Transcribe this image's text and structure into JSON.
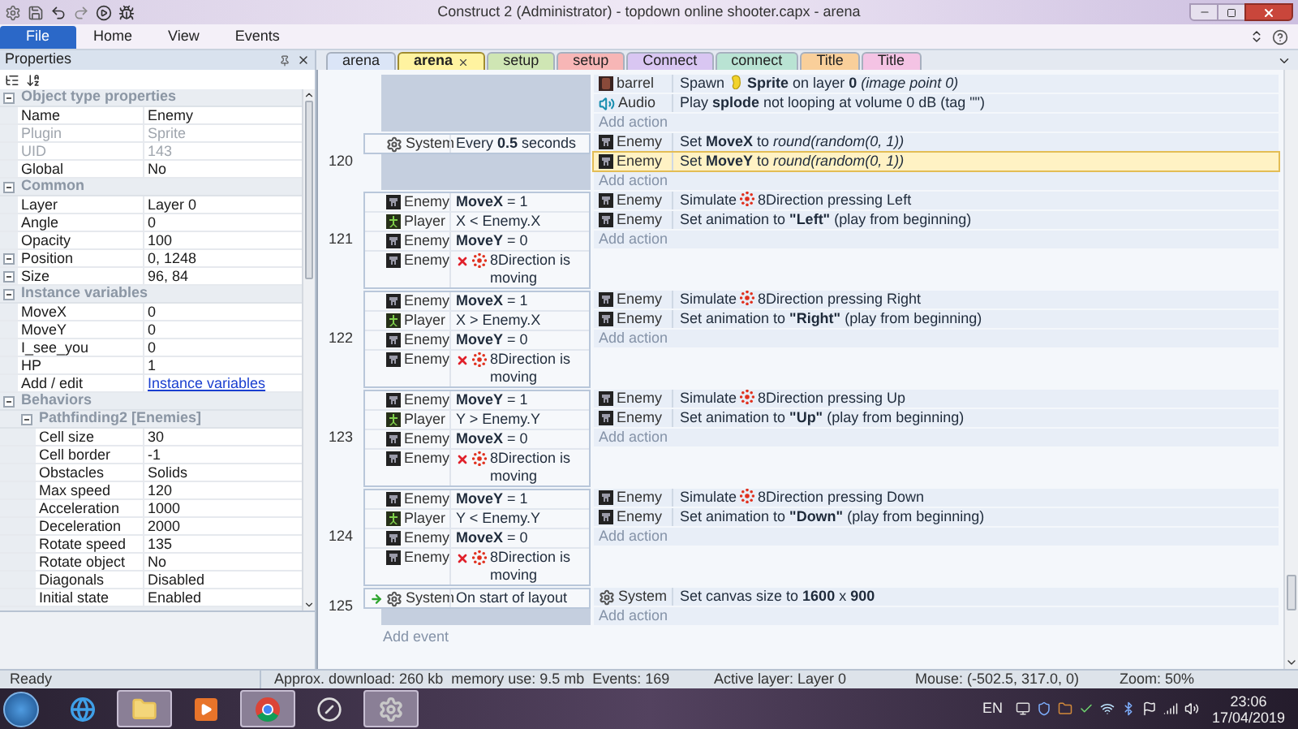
{
  "window": {
    "title": "Construct 2 (Administrator) - topdown online shooter.capx - arena"
  },
  "ribbon": [
    {
      "label": "File",
      "kind": "appmenu"
    },
    {
      "label": "Home",
      "kind": "tab"
    },
    {
      "label": "View",
      "kind": "tab"
    },
    {
      "label": "Events",
      "kind": "tab"
    }
  ],
  "properties": {
    "title": "Properties",
    "sections": [
      {
        "label": "Object type properties",
        "expanded": true,
        "rows": [
          {
            "name": "Name",
            "value": "Enemy",
            "disabled": false,
            "expandable": false,
            "link": false
          },
          {
            "name": "Plugin",
            "value": "Sprite",
            "disabled": true,
            "expandable": false,
            "link": false
          },
          {
            "name": "UID",
            "value": "143",
            "disabled": true,
            "expandable": false,
            "link": false
          },
          {
            "name": "Global",
            "value": "No",
            "disabled": false,
            "expandable": false,
            "link": false
          }
        ]
      },
      {
        "label": "Common",
        "expanded": true,
        "rows": [
          {
            "name": "Layer",
            "value": "Layer 0",
            "disabled": false,
            "expandable": false,
            "link": false
          },
          {
            "name": "Angle",
            "value": "0",
            "disabled": false,
            "expandable": false,
            "link": false
          },
          {
            "name": "Opacity",
            "value": "100",
            "disabled": false,
            "expandable": false,
            "link": false
          },
          {
            "name": "Position",
            "value": "0, 1248",
            "disabled": false,
            "expandable": true,
            "link": false
          },
          {
            "name": "Size",
            "value": "96, 84",
            "disabled": false,
            "expandable": true,
            "link": false
          }
        ]
      },
      {
        "label": "Instance variables",
        "expanded": true,
        "rows": [
          {
            "name": "MoveX",
            "value": "0",
            "disabled": false,
            "expandable": false,
            "link": false
          },
          {
            "name": "MoveY",
            "value": "0",
            "disabled": false,
            "expandable": false,
            "link": false
          },
          {
            "name": "I_see_you",
            "value": "0",
            "disabled": false,
            "expandable": false,
            "link": false
          },
          {
            "name": "HP",
            "value": "1",
            "disabled": false,
            "expandable": false,
            "link": false
          },
          {
            "name": "Add / edit",
            "value": "Instance variables",
            "disabled": false,
            "expandable": false,
            "link": true
          }
        ]
      },
      {
        "label": "Behaviors",
        "expanded": true,
        "subsections": [
          {
            "label": "Pathfinding2 [Enemies]",
            "expanded": true,
            "rows": [
              {
                "name": "Cell size",
                "value": "30",
                "disabled": false,
                "expandable": false,
                "link": false
              },
              {
                "name": "Cell border",
                "value": "-1",
                "disabled": false,
                "expandable": false,
                "link": false
              },
              {
                "name": "Obstacles",
                "value": "Solids",
                "disabled": false,
                "expandable": false,
                "link": false
              },
              {
                "name": "Max speed",
                "value": "120",
                "disabled": false,
                "expandable": false,
                "link": false
              },
              {
                "name": "Acceleration",
                "value": "1000",
                "disabled": false,
                "expandable": false,
                "link": false
              },
              {
                "name": "Deceleration",
                "value": "2000",
                "disabled": false,
                "expandable": false,
                "link": false
              },
              {
                "name": "Rotate speed",
                "value": "135",
                "disabled": false,
                "expandable": false,
                "link": false
              },
              {
                "name": "Rotate object",
                "value": "No",
                "disabled": false,
                "expandable": false,
                "link": false
              },
              {
                "name": "Diagonals",
                "value": "Disabled",
                "disabled": false,
                "expandable": false,
                "link": false
              },
              {
                "name": "Initial state",
                "value": "Enabled",
                "disabled": false,
                "expandable": false,
                "link": false
              }
            ]
          }
        ]
      }
    ]
  },
  "tabs": [
    {
      "label": "arena",
      "color": "#dbe5f7",
      "selected": false
    },
    {
      "label": "arena",
      "color": "#fff3a0",
      "selected": true
    },
    {
      "label": "setup",
      "color": "#cfe6b4",
      "selected": false
    },
    {
      "label": "setup",
      "color": "#f7b6b6",
      "selected": false
    },
    {
      "label": "Connect",
      "color": "#d9c6f2",
      "selected": false
    },
    {
      "label": "connect",
      "color": "#b9e3d3",
      "selected": false
    },
    {
      "label": "Title",
      "color": "#f9cf9a",
      "selected": false
    },
    {
      "label": "Title",
      "color": "#f4c3e4",
      "selected": false
    }
  ],
  "events": [
    {
      "actions": [
        {
          "object": "barrel",
          "kind": "barrel",
          "lead": "Spawn",
          "inline_icon": true,
          "text": "**Sprite** on layer **0** *(image point 0)*",
          "selected": false
        },
        {
          "object": "Audio",
          "kind": "audio",
          "inline_icon": false,
          "text": "Play **splode** not looping at volume 0 dB (tag \"\")",
          "selected": false
        }
      ],
      "add_action": "Add action"
    },
    {
      "number": "120",
      "trigger": false,
      "conditions": [
        {
          "object": "System",
          "kind": "system",
          "inline_icon": false,
          "text": "Every **0.5** seconds",
          "inverted": false
        }
      ],
      "actions": [
        {
          "object": "Enemy",
          "kind": "enemy",
          "inline_icon": false,
          "text": "Set **MoveX** to *round(random(0, 1))*",
          "selected": false
        },
        {
          "object": "Enemy",
          "kind": "enemy",
          "inline_icon": false,
          "text": "Set **MoveY** to *round(random(0, 1))*",
          "selected": true
        }
      ],
      "add_action": "Add action"
    },
    {
      "number": "121",
      "trigger": false,
      "conditions": [
        {
          "object": "Enemy",
          "kind": "enemy",
          "inline_icon": false,
          "text": "**MoveX** = 1",
          "inverted": false
        },
        {
          "object": "Player",
          "kind": "player",
          "inline_icon": false,
          "text": "X < Enemy.X",
          "inverted": false
        },
        {
          "object": "Enemy",
          "kind": "enemy",
          "inline_icon": false,
          "text": "**MoveY** = 0",
          "inverted": false
        },
        {
          "object": "Enemy",
          "kind": "enemy",
          "inline_icon": true,
          "text": "8Direction is moving",
          "inverted": true
        }
      ],
      "actions": [
        {
          "object": "Enemy",
          "kind": "enemy",
          "lead": "Simulate",
          "inline_icon": true,
          "text": "8Direction pressing Left",
          "selected": false
        },
        {
          "object": "Enemy",
          "kind": "enemy",
          "inline_icon": false,
          "text": "Set animation to **\"Left\"** (play from beginning)",
          "selected": false
        }
      ],
      "add_action": "Add action"
    },
    {
      "number": "122",
      "trigger": false,
      "conditions": [
        {
          "object": "Enemy",
          "kind": "enemy",
          "inline_icon": false,
          "text": "**MoveX** = 1",
          "inverted": false
        },
        {
          "object": "Player",
          "kind": "player",
          "inline_icon": false,
          "text": "X > Enemy.X",
          "inverted": false
        },
        {
          "object": "Enemy",
          "kind": "enemy",
          "inline_icon": false,
          "text": "**MoveY** = 0",
          "inverted": false
        },
        {
          "object": "Enemy",
          "kind": "enemy",
          "inline_icon": true,
          "text": "8Direction is moving",
          "inverted": true
        }
      ],
      "actions": [
        {
          "object": "Enemy",
          "kind": "enemy",
          "lead": "Simulate",
          "inline_icon": true,
          "text": "8Direction pressing Right",
          "selected": false
        },
        {
          "object": "Enemy",
          "kind": "enemy",
          "inline_icon": false,
          "text": "Set animation to **\"Right\"** (play from beginning)",
          "selected": false
        }
      ],
      "add_action": "Add action"
    },
    {
      "number": "123",
      "trigger": false,
      "conditions": [
        {
          "object": "Enemy",
          "kind": "enemy",
          "inline_icon": false,
          "text": "**MoveY** = 1",
          "inverted": false
        },
        {
          "object": "Player",
          "kind": "player",
          "inline_icon": false,
          "text": "Y > Enemy.Y",
          "inverted": false
        },
        {
          "object": "Enemy",
          "kind": "enemy",
          "inline_icon": false,
          "text": "**MoveX** = 0",
          "inverted": false
        },
        {
          "object": "Enemy",
          "kind": "enemy",
          "inline_icon": true,
          "text": "8Direction is moving",
          "inverted": true
        }
      ],
      "actions": [
        {
          "object": "Enemy",
          "kind": "enemy",
          "lead": "Simulate",
          "inline_icon": true,
          "text": "8Direction pressing Up",
          "selected": false
        },
        {
          "object": "Enemy",
          "kind": "enemy",
          "inline_icon": false,
          "text": "Set animation to **\"Up\"** (play from beginning)",
          "selected": false
        }
      ],
      "add_action": "Add action"
    },
    {
      "number": "124",
      "trigger": false,
      "conditions": [
        {
          "object": "Enemy",
          "kind": "enemy",
          "inline_icon": false,
          "text": "**MoveY** = 1",
          "inverted": false
        },
        {
          "object": "Player",
          "kind": "player",
          "inline_icon": false,
          "text": "Y < Enemy.Y",
          "inverted": false
        },
        {
          "object": "Enemy",
          "kind": "enemy",
          "inline_icon": false,
          "text": "**MoveX** = 0",
          "inverted": false
        },
        {
          "object": "Enemy",
          "kind": "enemy",
          "inline_icon": true,
          "text": "8Direction is moving",
          "inverted": true
        }
      ],
      "actions": [
        {
          "object": "Enemy",
          "kind": "enemy",
          "lead": "Simulate",
          "inline_icon": true,
          "text": "8Direction pressing Down",
          "selected": false
        },
        {
          "object": "Enemy",
          "kind": "enemy",
          "inline_icon": false,
          "text": "Set animation to **\"Down\"** (play from beginning)",
          "selected": false
        }
      ],
      "add_action": "Add action"
    },
    {
      "number": "125",
      "trigger": true,
      "conditions": [
        {
          "object": "System",
          "kind": "system",
          "inline_icon": false,
          "text": "On start of layout",
          "inverted": false
        }
      ],
      "actions": [
        {
          "object": "System",
          "kind": "system",
          "inline_icon": false,
          "text": "Set canvas size to **1600** x **900**",
          "selected": false
        }
      ],
      "add_action": "Add action"
    }
  ],
  "add_event": "Add event",
  "status_bar": {
    "state": "Ready",
    "info": [
      "Approx. download: 260 kb",
      "memory use: 9.5 mb",
      "Events: 169"
    ],
    "active_layer": "Active layer: Layer 0",
    "mouse": "Mouse: (-502.5, 317.0, 0)",
    "zoom": "Zoom: 50%"
  },
  "taskbar": {
    "apps": [
      {
        "kind": "ie",
        "running": false
      },
      {
        "kind": "folder",
        "running": true
      },
      {
        "kind": "media",
        "running": false
      },
      {
        "kind": "chrome",
        "running": true
      },
      {
        "kind": "xapp",
        "running": false
      },
      {
        "kind": "construct",
        "running": true
      }
    ],
    "language": "EN",
    "time": "23:06",
    "date": "17/04/2019"
  }
}
